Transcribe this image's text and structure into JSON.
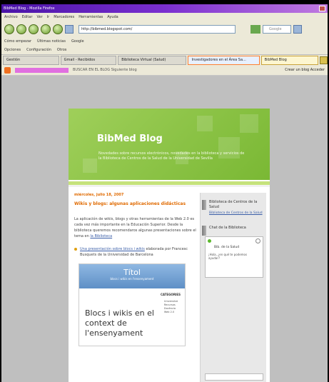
{
  "window": {
    "title": "BibMed Blog - Mozilla Firefox"
  },
  "menu": [
    "Archivo",
    "Editar",
    "Ver",
    "Ir",
    "Marcadores",
    "Herramientas",
    "Ayuda"
  ],
  "nav": {
    "url": "http://bibmed.blogspot.com/",
    "search_placeholder": "Google"
  },
  "links": [
    "Cómo empezar",
    "Últimas noticias",
    "Google"
  ],
  "linkbar2": [
    "Opciones",
    "Configuración",
    "Otros"
  ],
  "tabs": [
    {
      "label": "Gestión"
    },
    {
      "label": "Gmail - Recibidos"
    },
    {
      "label": "Biblioteca Virtual (Salud)"
    },
    {
      "label": "Investigadores en el Área Sa..."
    },
    {
      "label": "BibMed Blog"
    }
  ],
  "blogger_bar": {
    "search": "BUSCAR EN EL BLOG",
    "next": "Siguiente blog",
    "right": "Crear un blog  Acceder"
  },
  "blog": {
    "title": "BibMed Blog",
    "description": "Novedades sobre recursos electrónicos, novedades en la biblioteca y servicios de la Biblioteca de Centros de la Salud de la Universidad de Sevilla"
  },
  "post": {
    "date": "miércoles, julio 18, 2007",
    "title": "Wikis y blogs: algunas aplicaciones didácticas",
    "body": "La aplicación de wikis, blogs y otras herramientas de la Web 2.0 es cada vez más importante en la Educación Superior. Desde la biblioteca queremos recomendaros algunas presentaciones sobre el tema en",
    "body_link": "la Biblioteca",
    "bullet_link": "Una presentación sobre blocs i wikis",
    "bullet_text": "elaborada por Francesc Busquets de la Universidad de Barcelona",
    "thumb_title": "Títol",
    "thumb_subtitle": "blocs i wikis en l'ensenyament",
    "thumb_categories": "CATEGORIES",
    "thumb_catlist": [
      "Universitat",
      "Recursos",
      "Docència",
      "Web 2.0"
    ],
    "thumb_big": "Blocs i wikis en el context de l'ensenyament"
  },
  "sidebar": {
    "heading1": "Biblioteca de Centros de la Salud",
    "link1": "Biblioteca de Centros de la Salud",
    "heading2": "Chat de la Biblioteca",
    "chat_title": "Bib. de la Salud",
    "chat_msg": "¡Hola, ¿en qué te podemos ayudar?"
  }
}
